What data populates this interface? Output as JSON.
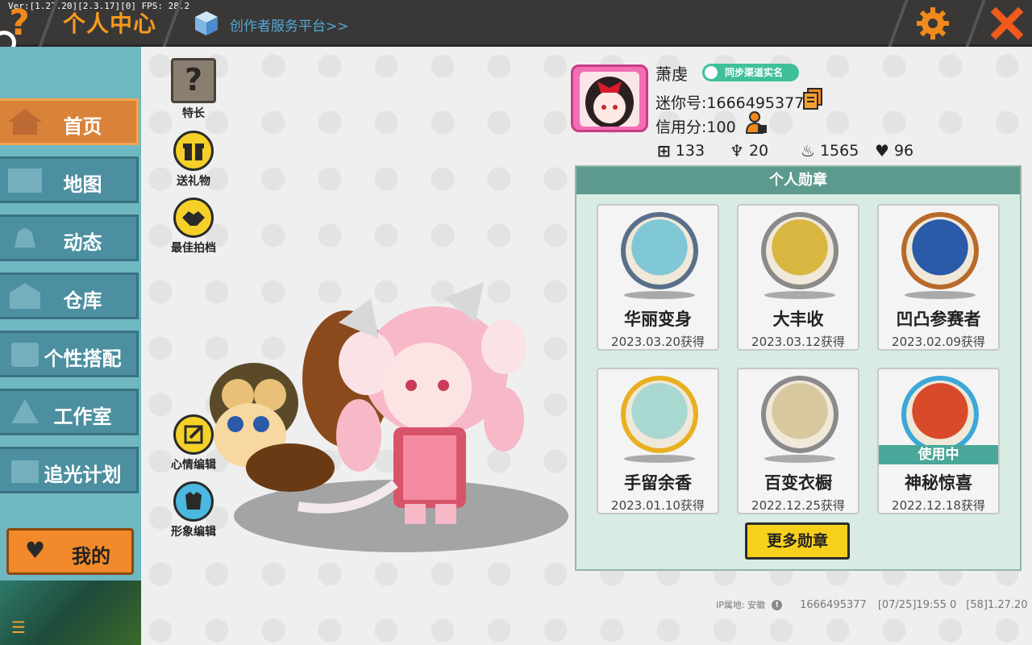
{
  "version_text": "Ver:[1.27.20][2.3.17][0] FPS: 28.2",
  "header": {
    "help_icon": "question-mark-icon",
    "title": "个人中心",
    "creator_link": "创作者服务平台>>",
    "settings_icon": "gear-icon",
    "close_icon": "close-x-icon",
    "accent_color": "#f59a1e"
  },
  "sidebar": {
    "items": [
      {
        "label": "首页",
        "icon": "house-icon",
        "active": true
      },
      {
        "label": "地图",
        "icon": "map-picture-icon",
        "active": false
      },
      {
        "label": "动态",
        "icon": "bell-icon",
        "active": false
      },
      {
        "label": "仓库",
        "icon": "warehouse-icon",
        "active": false
      },
      {
        "label": "个性搭配",
        "icon": "costume-icon",
        "active": false
      },
      {
        "label": "工作室",
        "icon": "studio-tree-icon",
        "active": false
      },
      {
        "label": "追光计划",
        "icon": "light-plan-icon",
        "active": false
      }
    ],
    "mine_label": "我的",
    "mine_icon": "heart-icon",
    "rss_icon": "rss-icon"
  },
  "actions": {
    "talent": "特长",
    "send_gift": "送礼物",
    "best_partner": "最佳拍档",
    "mood_edit": "心情编辑",
    "avatar_edit": "形象编辑"
  },
  "profile": {
    "nickname": "萧虔",
    "sync_badge": "同步渠道实名",
    "uid": "迷你号:1666495377",
    "credit": "信用分:100",
    "stats": {
      "plus": "133",
      "fans": "20",
      "fire": "1565",
      "likes": "96"
    }
  },
  "medals": {
    "title": "个人勋章",
    "items": [
      {
        "name": "华丽变身",
        "date": "2023.03.20获得",
        "ring": "#5a6f8a",
        "fill": "#7fc7d4",
        "in_use": false
      },
      {
        "name": "大丰收",
        "date": "2023.03.12获得",
        "ring": "#8a8a8a",
        "fill": "#d8b640",
        "in_use": false
      },
      {
        "name": "凹凸参赛者",
        "date": "2023.02.09获得",
        "ring": "#b86a2a",
        "fill": "#2a5aa8",
        "in_use": false
      },
      {
        "name": "手留余香",
        "date": "2023.01.10获得",
        "ring": "#e8b020",
        "fill": "#a8d8d0",
        "in_use": false
      },
      {
        "name": "百变衣橱",
        "date": "2022.12.25获得",
        "ring": "#8a8a8a",
        "fill": "#d8c8a0",
        "in_use": false
      },
      {
        "name": "神秘惊喜",
        "date": "2022.12.18获得",
        "ring": "#3aa8d8",
        "fill": "#d84a2a",
        "in_use": true,
        "in_use_label": "使用中"
      }
    ],
    "more_button": "更多勋章"
  },
  "footer": {
    "ip_label": "IP属地: 安徽",
    "uid": "1666495377",
    "time": "[07/25]19:55 0",
    "build": "[58]1.27.20"
  }
}
